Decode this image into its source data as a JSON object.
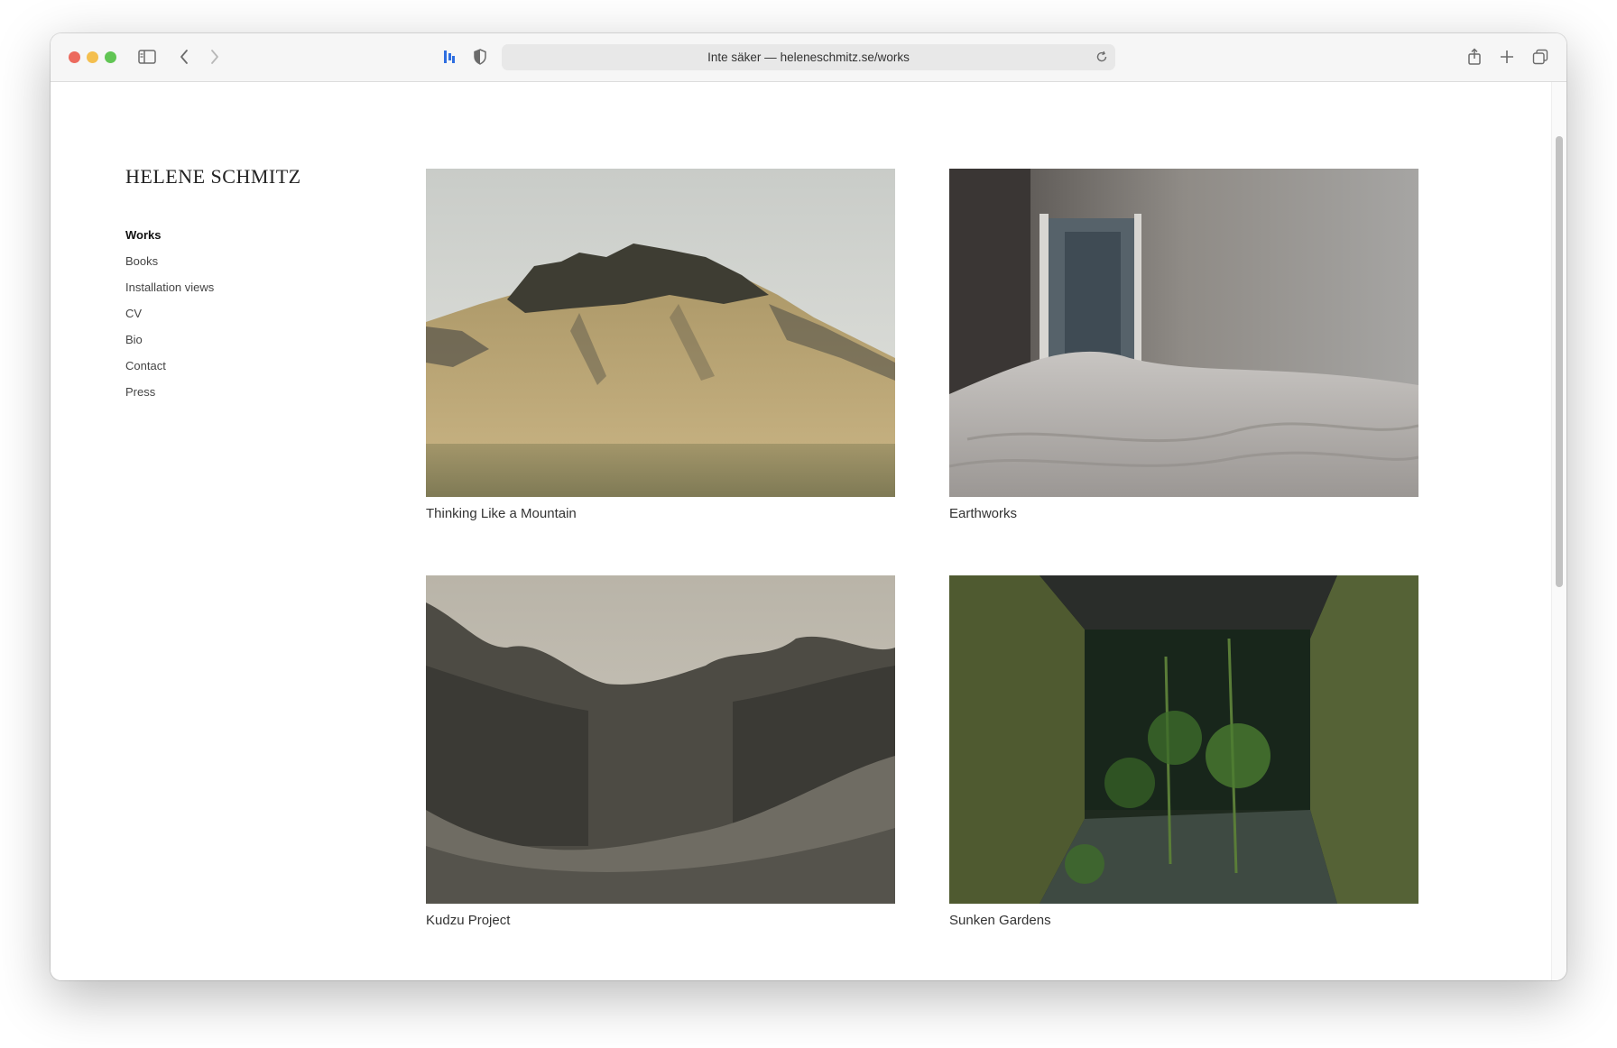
{
  "browser": {
    "url_prefix": "Inte säker —",
    "url_host": "heleneschmitz.se/works"
  },
  "site": {
    "title": "HELENE SCHMITZ"
  },
  "nav": {
    "items": [
      {
        "label": "Works",
        "active": true
      },
      {
        "label": "Books"
      },
      {
        "label": "Installation views"
      },
      {
        "label": "CV"
      },
      {
        "label": "Bio"
      },
      {
        "label": "Contact"
      },
      {
        "label": "Press"
      }
    ]
  },
  "works": [
    {
      "caption": "Thinking Like a Mountain"
    },
    {
      "caption": "Earthworks"
    },
    {
      "caption": "Kudzu Project"
    },
    {
      "caption": "Sunken Gardens"
    }
  ]
}
